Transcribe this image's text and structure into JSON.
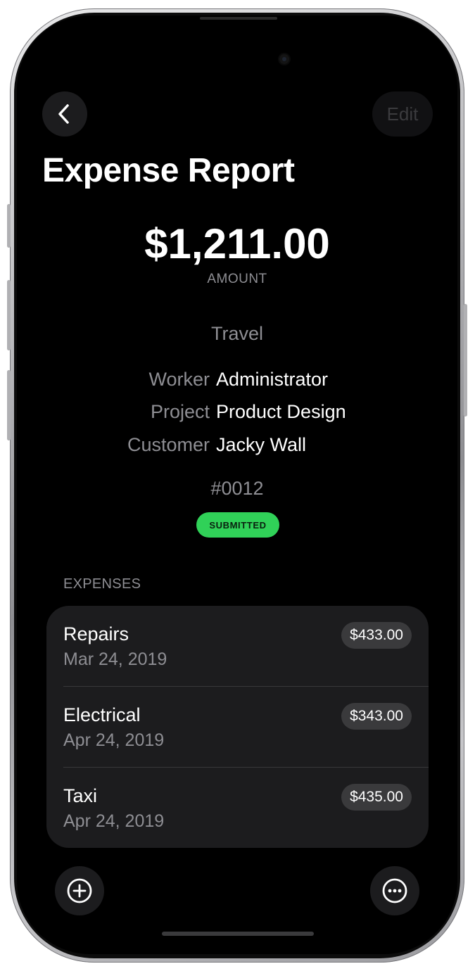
{
  "nav": {
    "edit_label": "Edit"
  },
  "header": {
    "title": "Expense Report"
  },
  "summary": {
    "amount": "$1,211.00",
    "amount_label": "AMOUNT",
    "category": "Travel",
    "details": [
      {
        "label": "Worker",
        "value": "Administrator"
      },
      {
        "label": "Project",
        "value": "Product Design"
      },
      {
        "label": "Customer",
        "value": "Jacky Wall"
      }
    ],
    "report_number": "#0012",
    "status": "SUBMITTED",
    "status_color": "#30d158"
  },
  "expenses": {
    "section_title": "EXPENSES",
    "items": [
      {
        "name": "Repairs",
        "date": "Mar 24, 2019",
        "amount": "$433.00"
      },
      {
        "name": "Electrical",
        "date": "Apr 24, 2019",
        "amount": "$343.00"
      },
      {
        "name": "Taxi",
        "date": "Apr 24, 2019",
        "amount": "$435.00"
      }
    ]
  },
  "icons": {
    "back": "chevron-left-icon",
    "add": "plus-circle-icon",
    "more": "ellipsis-circle-icon"
  },
  "theme": {
    "background": "#000000",
    "card": "#1c1c1e",
    "secondary_text": "#8e8e93",
    "accent": "#30d158"
  }
}
